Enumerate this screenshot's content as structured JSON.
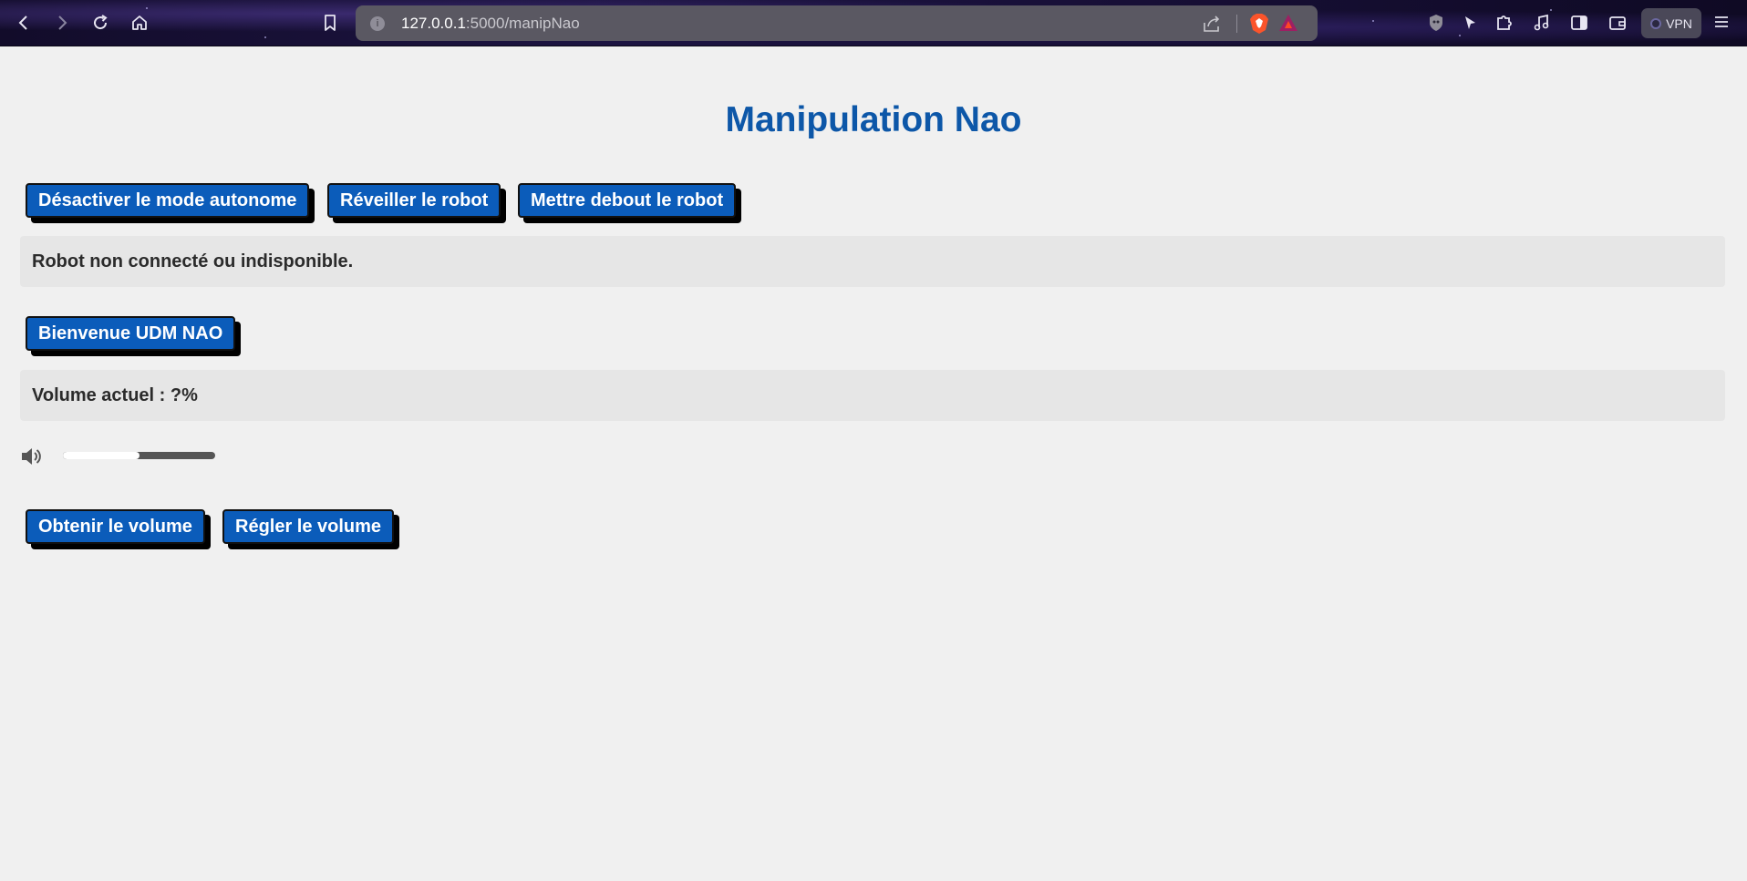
{
  "browser": {
    "url_host": "127.0.0.1",
    "url_path": ":5000/manipNao",
    "vpn_label": "VPN"
  },
  "page": {
    "title": "Manipulation Nao",
    "top_buttons": [
      "Désactiver le mode autonome",
      "Réveiller le robot",
      "Mettre debout le robot"
    ],
    "robot_status": "Robot non connecté ou indisponible.",
    "welcome_button": "Bienvenue UDM NAO",
    "volume_status": "Volume actuel : ?%",
    "volume_slider_level": 0.5,
    "volume_buttons": [
      "Obtenir le volume",
      "Régler le volume"
    ]
  },
  "colors": {
    "accent": "#0b5cba",
    "title": "#0d57a8",
    "background": "#f0f0f0",
    "status_box": "#e6e6e6"
  }
}
